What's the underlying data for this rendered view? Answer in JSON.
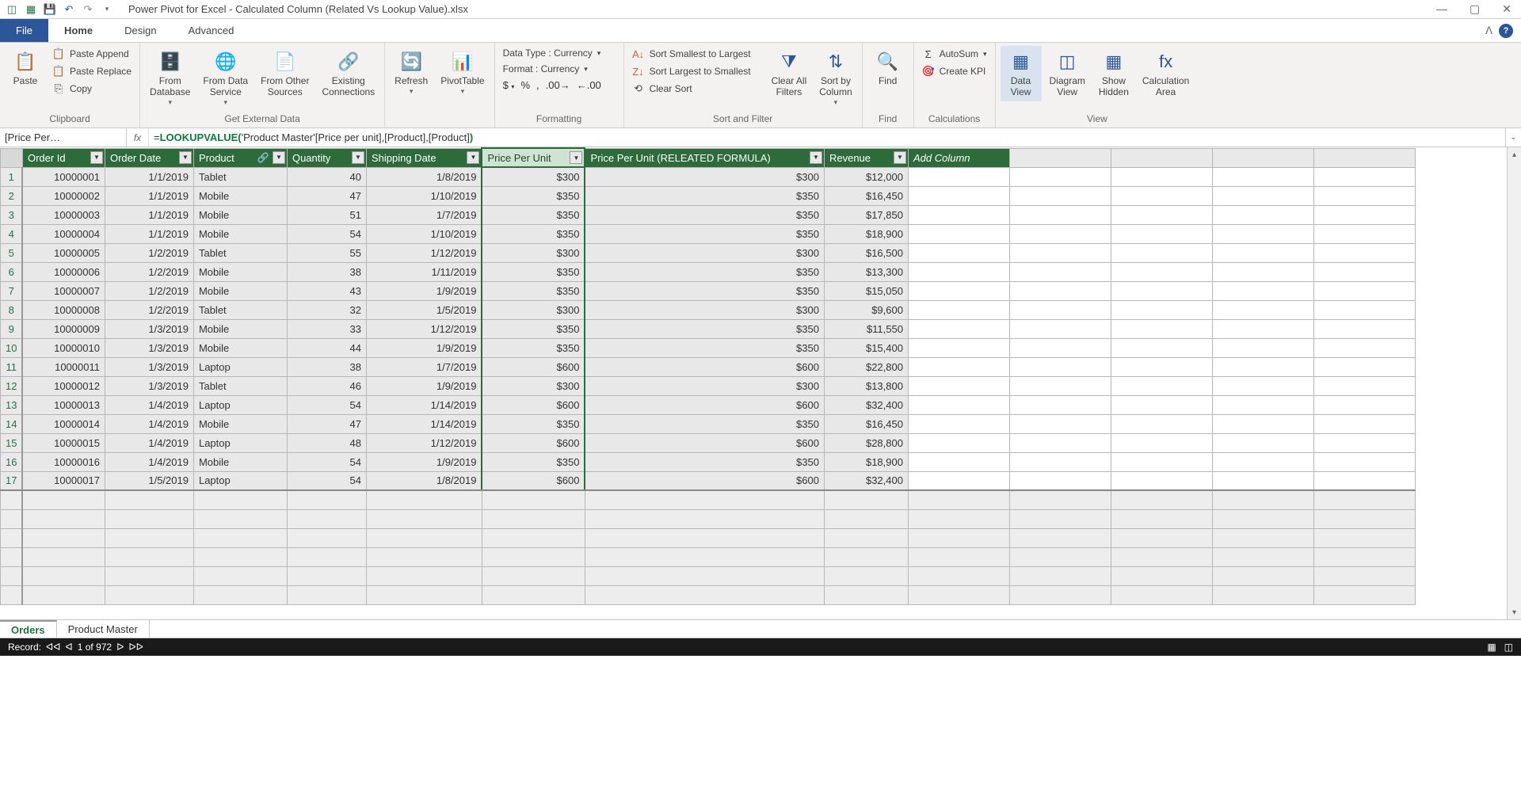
{
  "title": "Power Pivot for Excel - Calculated Column (Related Vs Lookup Value).xlsx",
  "menu": {
    "file": "File",
    "home": "Home",
    "design": "Design",
    "advanced": "Advanced"
  },
  "ribbon": {
    "clipboard": {
      "paste": "Paste",
      "append": "Paste Append",
      "replace": "Paste Replace",
      "copy": "Copy",
      "label": "Clipboard"
    },
    "getdata": {
      "fromdb": "From\nDatabase",
      "fromds": "From Data\nService",
      "fromother": "From Other\nSources",
      "existing": "Existing\nConnections",
      "label": "Get External Data"
    },
    "refresh": "Refresh",
    "pivot": "PivotTable",
    "formatting": {
      "datatype": "Data Type : Currency",
      "format": "Format : Currency",
      "label": "Formatting"
    },
    "sort": {
      "asc": "Sort Smallest to Largest",
      "desc": "Sort Largest to Smallest",
      "clear": "Clear Sort",
      "clearfilters": "Clear All\nFilters",
      "sortby": "Sort by\nColumn",
      "label": "Sort and Filter"
    },
    "find": {
      "btn": "Find",
      "label": "Find"
    },
    "calc": {
      "autosum": "AutoSum",
      "kpi": "Create KPI",
      "label": "Calculations"
    },
    "view": {
      "data": "Data\nView",
      "diagram": "Diagram\nView",
      "hidden": "Show\nHidden",
      "calcarea": "Calculation\nArea",
      "label": "View"
    }
  },
  "formula_bar": {
    "name": "[Price Per…",
    "fx": "fx",
    "eq": "=",
    "fn": "LOOKUPVALUE(",
    "args": "'Product Master'[Price per unit],[Product],[Product]",
    "close": ")"
  },
  "columns": [
    "Order Id",
    "Order Date",
    "Product",
    "Quantity",
    "Shipping Date",
    "Price Per Unit",
    "Price Per Unit (RELEATED FORMULA)",
    "Revenue"
  ],
  "addcol": "Add Column",
  "rows": [
    {
      "n": 1,
      "id": "10000001",
      "date": "1/1/2019",
      "prod": "Tablet",
      "qty": 40,
      "ship": "1/8/2019",
      "ppu": "$300",
      "ppu2": "$300",
      "rev": "$12,000"
    },
    {
      "n": 2,
      "id": "10000002",
      "date": "1/1/2019",
      "prod": "Mobile",
      "qty": 47,
      "ship": "1/10/2019",
      "ppu": "$350",
      "ppu2": "$350",
      "rev": "$16,450"
    },
    {
      "n": 3,
      "id": "10000003",
      "date": "1/1/2019",
      "prod": "Mobile",
      "qty": 51,
      "ship": "1/7/2019",
      "ppu": "$350",
      "ppu2": "$350",
      "rev": "$17,850"
    },
    {
      "n": 4,
      "id": "10000004",
      "date": "1/1/2019",
      "prod": "Mobile",
      "qty": 54,
      "ship": "1/10/2019",
      "ppu": "$350",
      "ppu2": "$350",
      "rev": "$18,900"
    },
    {
      "n": 5,
      "id": "10000005",
      "date": "1/2/2019",
      "prod": "Tablet",
      "qty": 55,
      "ship": "1/12/2019",
      "ppu": "$300",
      "ppu2": "$300",
      "rev": "$16,500"
    },
    {
      "n": 6,
      "id": "10000006",
      "date": "1/2/2019",
      "prod": "Mobile",
      "qty": 38,
      "ship": "1/11/2019",
      "ppu": "$350",
      "ppu2": "$350",
      "rev": "$13,300"
    },
    {
      "n": 7,
      "id": "10000007",
      "date": "1/2/2019",
      "prod": "Mobile",
      "qty": 43,
      "ship": "1/9/2019",
      "ppu": "$350",
      "ppu2": "$350",
      "rev": "$15,050"
    },
    {
      "n": 8,
      "id": "10000008",
      "date": "1/2/2019",
      "prod": "Tablet",
      "qty": 32,
      "ship": "1/5/2019",
      "ppu": "$300",
      "ppu2": "$300",
      "rev": "$9,600"
    },
    {
      "n": 9,
      "id": "10000009",
      "date": "1/3/2019",
      "prod": "Mobile",
      "qty": 33,
      "ship": "1/12/2019",
      "ppu": "$350",
      "ppu2": "$350",
      "rev": "$11,550"
    },
    {
      "n": 10,
      "id": "10000010",
      "date": "1/3/2019",
      "prod": "Mobile",
      "qty": 44,
      "ship": "1/9/2019",
      "ppu": "$350",
      "ppu2": "$350",
      "rev": "$15,400"
    },
    {
      "n": 11,
      "id": "10000011",
      "date": "1/3/2019",
      "prod": "Laptop",
      "qty": 38,
      "ship": "1/7/2019",
      "ppu": "$600",
      "ppu2": "$600",
      "rev": "$22,800"
    },
    {
      "n": 12,
      "id": "10000012",
      "date": "1/3/2019",
      "prod": "Tablet",
      "qty": 46,
      "ship": "1/9/2019",
      "ppu": "$300",
      "ppu2": "$300",
      "rev": "$13,800"
    },
    {
      "n": 13,
      "id": "10000013",
      "date": "1/4/2019",
      "prod": "Laptop",
      "qty": 54,
      "ship": "1/14/2019",
      "ppu": "$600",
      "ppu2": "$600",
      "rev": "$32,400"
    },
    {
      "n": 14,
      "id": "10000014",
      "date": "1/4/2019",
      "prod": "Mobile",
      "qty": 47,
      "ship": "1/14/2019",
      "ppu": "$350",
      "ppu2": "$350",
      "rev": "$16,450"
    },
    {
      "n": 15,
      "id": "10000015",
      "date": "1/4/2019",
      "prod": "Laptop",
      "qty": 48,
      "ship": "1/12/2019",
      "ppu": "$600",
      "ppu2": "$600",
      "rev": "$28,800"
    },
    {
      "n": 16,
      "id": "10000016",
      "date": "1/4/2019",
      "prod": "Mobile",
      "qty": 54,
      "ship": "1/9/2019",
      "ppu": "$350",
      "ppu2": "$350",
      "rev": "$18,900"
    },
    {
      "n": 17,
      "id": "10000017",
      "date": "1/5/2019",
      "prod": "Laptop",
      "qty": 54,
      "ship": "1/8/2019",
      "ppu": "$600",
      "ppu2": "$600",
      "rev": "$32,400"
    }
  ],
  "sheets": {
    "active": "Orders",
    "other": "Product Master"
  },
  "status": {
    "record": "Record:",
    "pos": "1 of 972"
  }
}
